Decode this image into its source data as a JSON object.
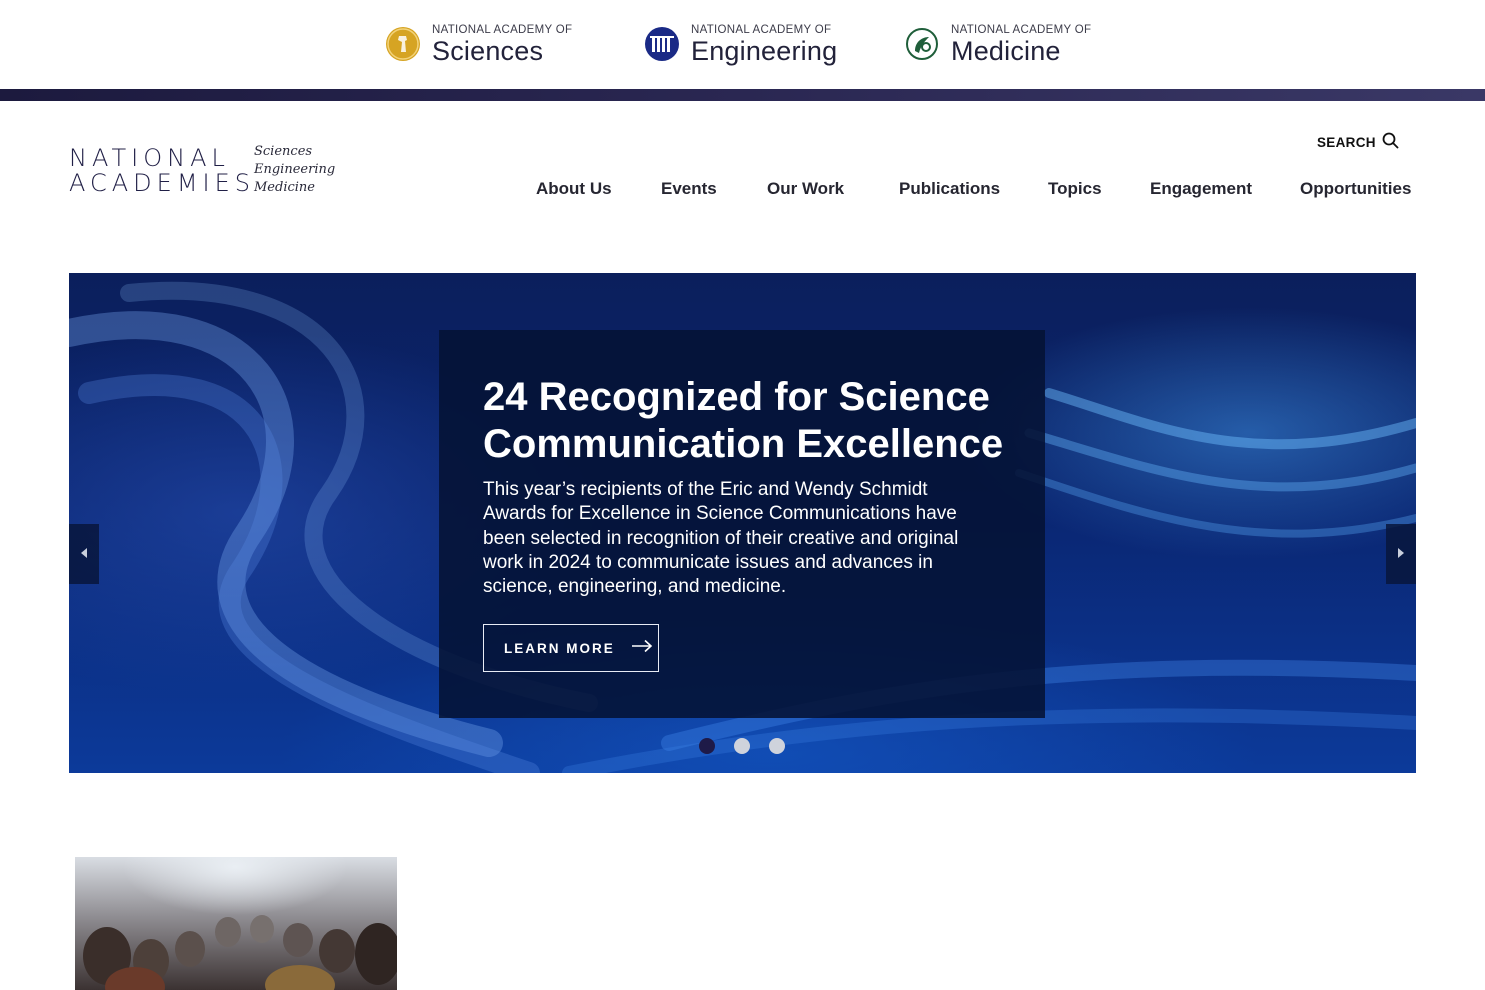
{
  "academies": [
    {
      "small": "NATIONAL ACADEMY OF",
      "big": "Sciences",
      "icon": "nas-seal-icon",
      "color": "#d6a423"
    },
    {
      "small": "NATIONAL ACADEMY OF",
      "big": "Engineering",
      "icon": "nae-seal-icon",
      "color": "#1a2a86"
    },
    {
      "small": "NATIONAL ACADEMY OF",
      "big": "Medicine",
      "icon": "nam-seal-icon",
      "color": "#1f5e3a"
    }
  ],
  "logo": {
    "line1": "NATIONAL",
    "line2": "ACADEMIES",
    "sub1": "Sciences",
    "sub2": "Engineering",
    "sub3": "Medicine"
  },
  "header": {
    "search_label": "SEARCH",
    "nav": [
      "About Us",
      "Events",
      "Our Work",
      "Publications",
      "Topics",
      "Engagement",
      "Opportunities"
    ]
  },
  "hero": {
    "title": "24 Recognized for Science Communication Excellence",
    "body": "This year’s recipients of the Eric and Wendy Schmidt Awards for Excellence in Science Communications have been selected in recognition of their creative and original work in 2024 to communicate issues and advances in science, engineering, and medicine.",
    "button_label": "LEARN MORE",
    "slide_count": 3,
    "active_slide": 1
  },
  "colors": {
    "brand_navy": "#201f46",
    "accent_bar": "#2a2752",
    "active_dot": "#1e1a48"
  }
}
